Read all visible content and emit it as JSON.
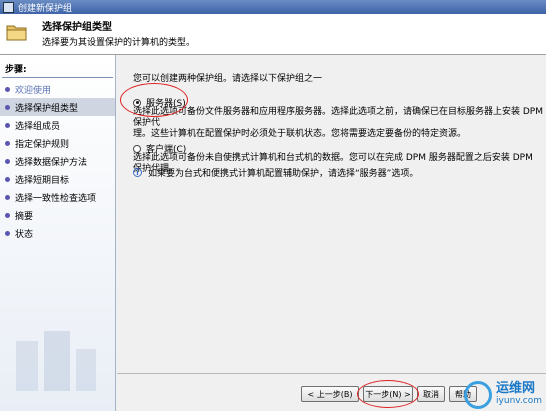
{
  "window": {
    "title": "创建新保护组"
  },
  "header": {
    "title": "选择保护组类型",
    "subtitle": "选择要为其设置保护的计算机的类型。"
  },
  "sidebar": {
    "steps_label": "步骤:",
    "items": [
      {
        "label": "欢迎使用",
        "state": "done"
      },
      {
        "label": "选择保护组类型",
        "state": "active"
      },
      {
        "label": "选择组成员",
        "state": "pending"
      },
      {
        "label": "指定保护规则",
        "state": "pending"
      },
      {
        "label": "选择数据保护方法",
        "state": "pending"
      },
      {
        "label": "选择短期目标",
        "state": "pending"
      },
      {
        "label": "选择一致性检查选项",
        "state": "pending"
      },
      {
        "label": "摘要",
        "state": "pending"
      },
      {
        "label": "状态",
        "state": "pending"
      }
    ]
  },
  "main": {
    "intro": "您可以创建两种保护组。请选择以下保护组之一",
    "options": [
      {
        "label": "服务器(S)",
        "checked": true,
        "desc_line1": "选择此选项可备份文件服务器和应用程序服务器。选择此选项之前，请确保已在目标服务器上安装 DPM 保护代",
        "desc_line2": "理。这些计算机在配置保护时必须处于联机状态。您将需要选定要备份的特定资源。"
      },
      {
        "label": "客户端(C)",
        "checked": false,
        "desc_line1": "选择此选项可备份未自使携式计算机和台式机的数据。您可以在完成 DPM 服务器配置之后安装 DPM 保护代理。"
      }
    ],
    "info": "如果要为台式和便携式计算机配置辅助保护，请选择“服务器”选项。"
  },
  "footer": {
    "back": "< 上一步(B)",
    "next": "下一步(N) >",
    "cancel": "取消",
    "help": "帮助"
  },
  "watermark": {
    "line1": "运维网",
    "line2": "iyunv.com"
  },
  "colors": {
    "annotation": "#e02020",
    "link": "#5b73b4",
    "bullet": "#5a56b0"
  }
}
